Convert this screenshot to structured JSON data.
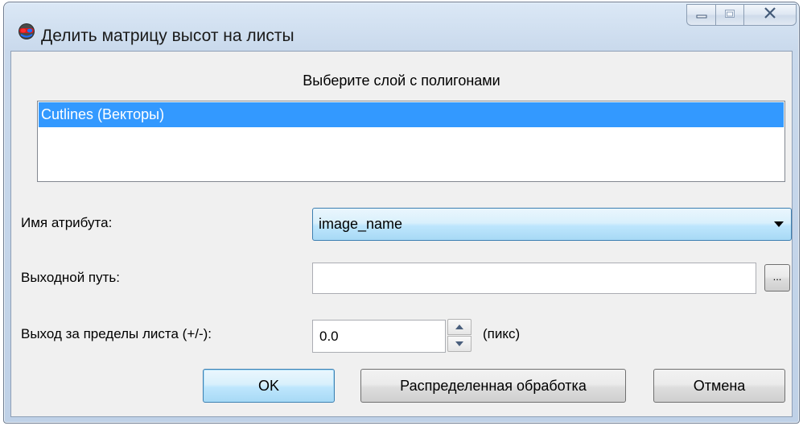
{
  "window": {
    "title": "Делить матрицу высот на листы",
    "app_icon": "stereo-glasses-icon",
    "caption_buttons": [
      "minimize-icon",
      "maximize-icon",
      "close-icon"
    ]
  },
  "layer_section": {
    "heading": "Выберите слой с полигонами",
    "items": [
      {
        "label": "Cutlines (Векторы)",
        "selected": true
      }
    ]
  },
  "attribute": {
    "label": "Имя атрибута:",
    "selected_value": "image_name"
  },
  "output_path": {
    "label": "Выходной путь:",
    "value": "",
    "browse_label": "..."
  },
  "overlap": {
    "label": "Выход за пределы листа (+/-):",
    "value": "0.0",
    "unit": "(пикс)"
  },
  "buttons": {
    "ok": "OK",
    "distributed": "Распределенная обработка",
    "cancel": "Отмена"
  },
  "colors": {
    "selection": "#3399ff",
    "accent_border": "#3c7fb1"
  }
}
